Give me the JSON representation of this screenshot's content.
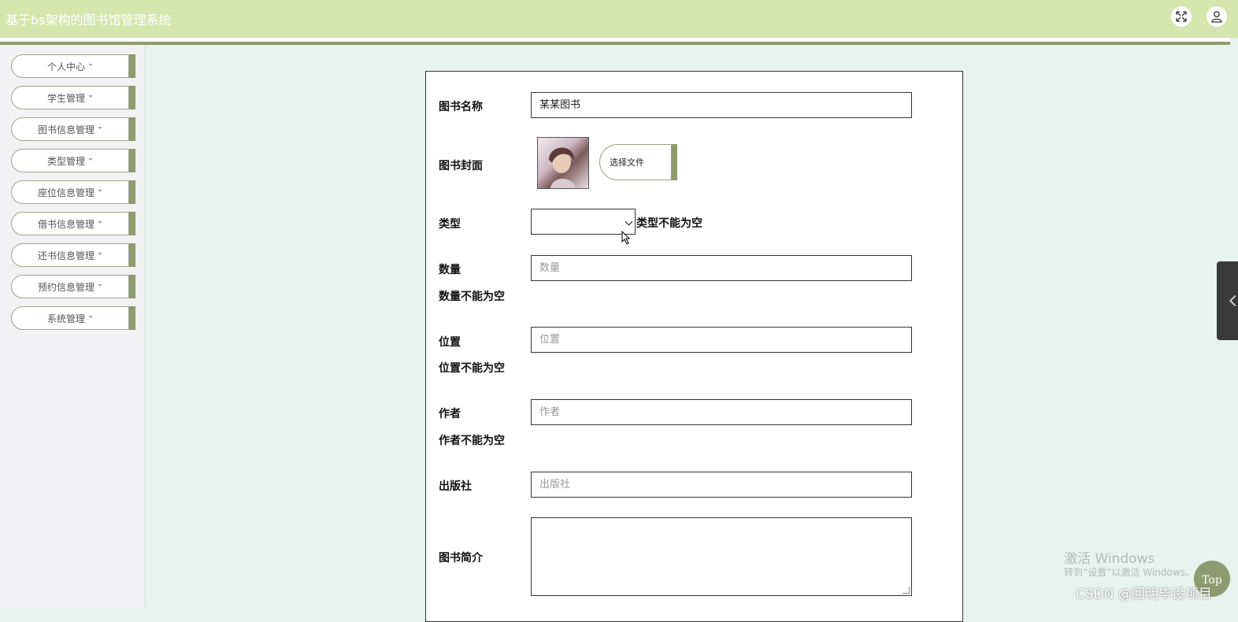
{
  "header": {
    "title": "基于bs架构的图书馆管理系统",
    "fullscreen_icon": "expand-icon",
    "user_icon": "user-icon"
  },
  "sidebar": {
    "items": [
      {
        "label": "个人中心"
      },
      {
        "label": "学生管理"
      },
      {
        "label": "图书信息管理"
      },
      {
        "label": "类型管理"
      },
      {
        "label": "座位信息管理"
      },
      {
        "label": "借书信息管理"
      },
      {
        "label": "还书信息管理"
      },
      {
        "label": "预约信息管理"
      },
      {
        "label": "系统管理"
      }
    ]
  },
  "form": {
    "book_name": {
      "label": "图书名称",
      "value": "某某图书"
    },
    "cover": {
      "label": "图书封面",
      "button": "选择文件"
    },
    "type": {
      "label": "类型",
      "value": "",
      "error": "类型不能为空"
    },
    "quantity": {
      "label": "数量",
      "placeholder": "数量",
      "error": "数量不能为空"
    },
    "location": {
      "label": "位置",
      "placeholder": "位置",
      "error": "位置不能为空"
    },
    "author": {
      "label": "作者",
      "placeholder": "作者",
      "error": "作者不能为空"
    },
    "publisher": {
      "label": "出版社",
      "placeholder": "出版社"
    },
    "intro": {
      "label": "图书简介",
      "value": ""
    }
  },
  "overlay": {
    "watermark_line1": "激活 Windows",
    "watermark_line2": "转到“设置”以激活 Windows。",
    "top_button": "Top",
    "csdn": "CSDN @回明毕设项目"
  },
  "colors": {
    "header_bg": "#d5e5ad",
    "accent": "#8e9b6f",
    "content_bg": "#e8f2ee",
    "sidebar_bg": "#f2f2f4"
  }
}
